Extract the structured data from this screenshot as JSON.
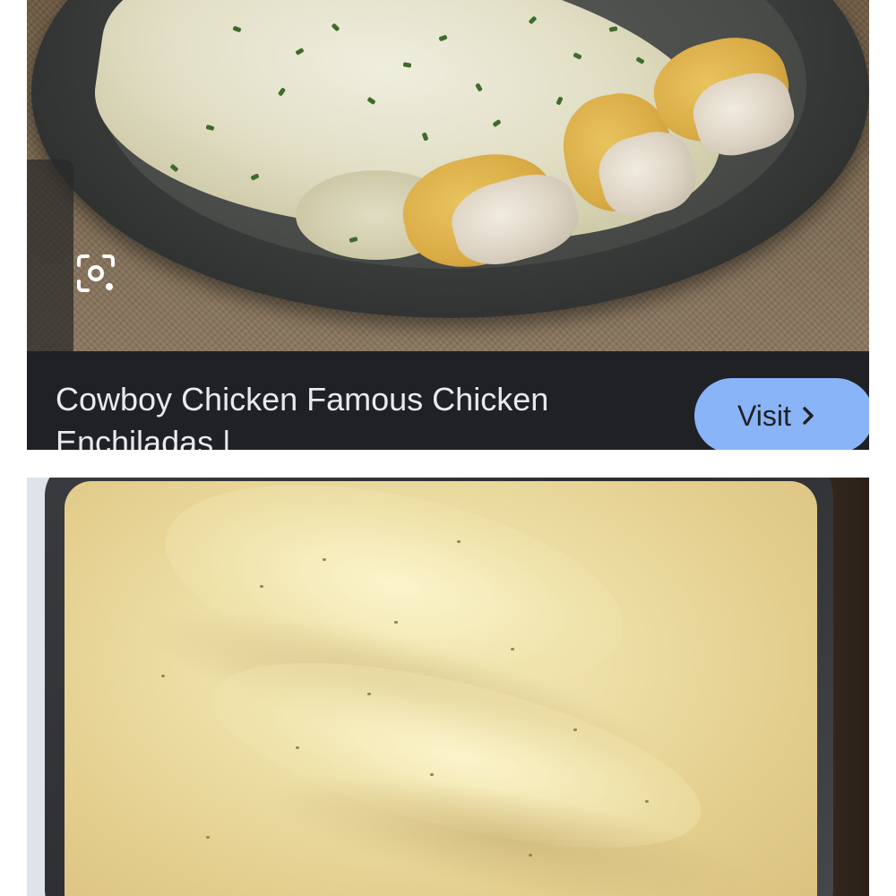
{
  "result_card": {
    "title": "Cowboy Chicken Famous Chicken Enchiladas |",
    "visit_label": "Visit"
  },
  "icons": {
    "side_handle": "chevron-right-icon",
    "lens": "lens-icon",
    "visit": "chevron-right-icon"
  },
  "colors": {
    "card_background": "#202124",
    "title_text": "#e8eaed",
    "visit_button": "#8ab4f8"
  }
}
